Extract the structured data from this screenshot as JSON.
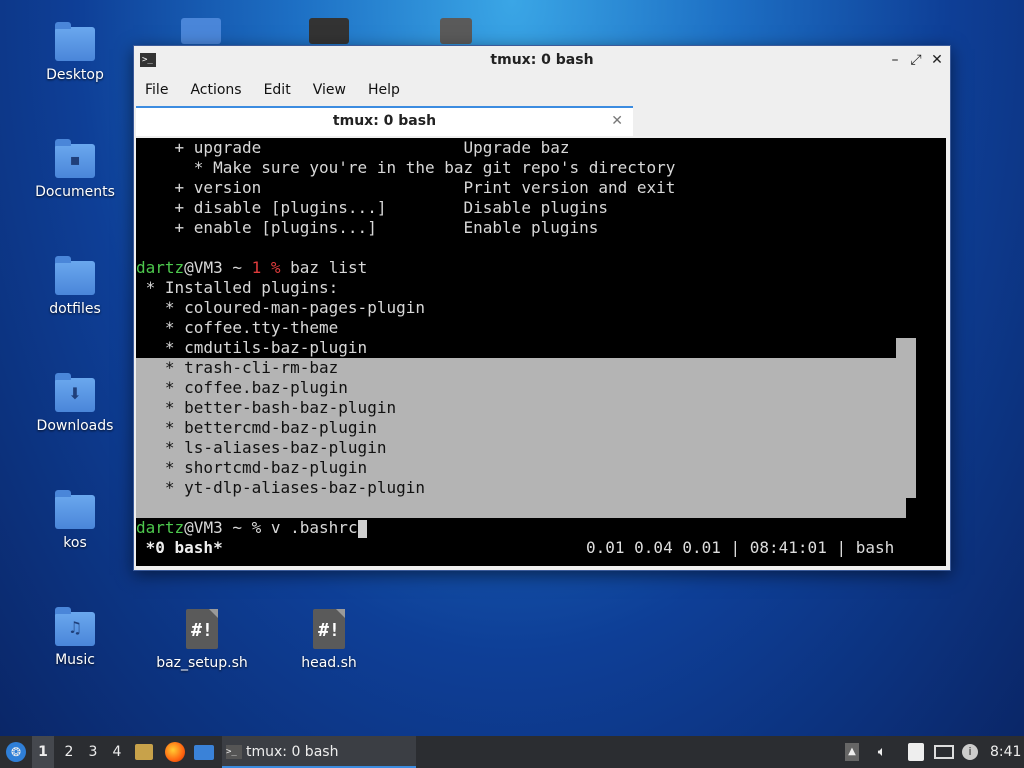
{
  "desktop": {
    "icons": [
      {
        "label": "Desktop"
      },
      {
        "label": "Documents"
      },
      {
        "label": "dotfiles"
      },
      {
        "label": "Downloads"
      },
      {
        "label": "kos"
      },
      {
        "label": "Music"
      },
      {
        "label": "baz_setup.sh"
      },
      {
        "label": "head.sh"
      }
    ]
  },
  "window": {
    "title": "tmux: 0 bash",
    "menu": [
      "File",
      "Actions",
      "Edit",
      "View",
      "Help"
    ],
    "tab_title": "tmux: 0 bash",
    "terminal": {
      "lines": [
        "    + upgrade                     Upgrade baz",
        "      * Make sure you're in the baz git repo's directory",
        "    + version                     Print version and exit",
        "    + disable [plugins...]        Disable plugins",
        "    + enable [plugins...]         Enable plugins",
        ""
      ],
      "prompt1": {
        "user": "dartz",
        "host": "@VM3 ~ ",
        "code": "1",
        "sym": " % ",
        "cmd": "baz list"
      },
      "output": [
        " * Installed plugins:",
        "   * coloured-man-pages-plugin",
        "   * coffee.tty-theme",
        "   * cmdutils-baz-plugin",
        "   * trash-cli-rm-baz",
        "   * coffee.baz-plugin",
        "   * better-bash-baz-plugin",
        "   * bettercmd-baz-plugin",
        "   * ls-aliases-baz-plugin",
        "   * shortcmd-baz-plugin",
        "   * yt-dlp-aliases-baz-plugin"
      ],
      "prompt2": {
        "user": "dartz",
        "host": "@VM3 ~ % ",
        "cmd": "v .bashrc"
      },
      "status_left": " *0 bash*",
      "status_right": "0.01 0.04 0.01 | 08:41:01 | bash"
    }
  },
  "taskbar": {
    "workspaces": [
      "1",
      "2",
      "3",
      "4"
    ],
    "task_label": "tmux: 0 bash",
    "clock": "8:41"
  }
}
